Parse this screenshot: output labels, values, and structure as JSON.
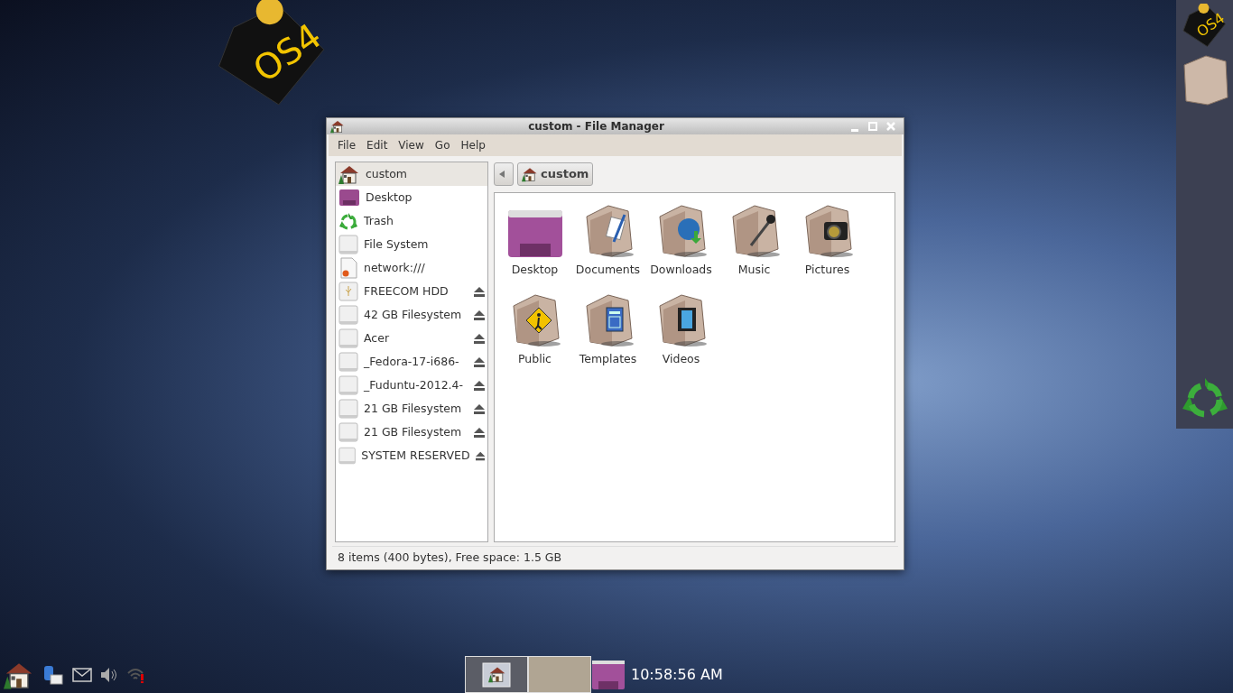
{
  "desktop_logo": {
    "text": "OS4"
  },
  "dock": [
    {
      "kind": "logo",
      "text": "OS4"
    },
    {
      "kind": "folder"
    },
    {
      "kind": "trash"
    }
  ],
  "window": {
    "title": "custom - File Manager"
  },
  "menu": [
    "File",
    "Edit",
    "View",
    "Go",
    "Help"
  ],
  "sidebar": {
    "items": [
      {
        "label": "custom",
        "kind": "home",
        "selected": true,
        "eject": false
      },
      {
        "label": "Desktop",
        "kind": "desktop",
        "selected": false,
        "eject": false
      },
      {
        "label": "Trash",
        "kind": "trash",
        "selected": false,
        "eject": false
      },
      {
        "label": "File System",
        "kind": "drive",
        "selected": false,
        "eject": false
      },
      {
        "label": "network:///",
        "kind": "network",
        "selected": false,
        "eject": false
      },
      {
        "label": "FREECOM HDD",
        "kind": "usb",
        "selected": false,
        "eject": true
      },
      {
        "label": "42 GB Filesystem",
        "kind": "drive",
        "selected": false,
        "eject": true
      },
      {
        "label": "Acer",
        "kind": "drive",
        "selected": false,
        "eject": true
      },
      {
        "label": "_Fedora-17-i686-",
        "kind": "drive",
        "selected": false,
        "eject": true
      },
      {
        "label": "_Fuduntu-2012.4-",
        "kind": "drive",
        "selected": false,
        "eject": true
      },
      {
        "label": "21 GB Filesystem",
        "kind": "drive",
        "selected": false,
        "eject": true
      },
      {
        "label": "21 GB Filesystem",
        "kind": "drive",
        "selected": false,
        "eject": true
      },
      {
        "label": "SYSTEM RESERVED",
        "kind": "drive",
        "selected": false,
        "eject": true
      }
    ]
  },
  "path_bar": {
    "button": "custom"
  },
  "files": [
    {
      "name": "Desktop",
      "kind": "desktop"
    },
    {
      "name": "Documents",
      "kind": "documents"
    },
    {
      "name": "Downloads",
      "kind": "downloads"
    },
    {
      "name": "Music",
      "kind": "music"
    },
    {
      "name": "Pictures",
      "kind": "pictures"
    },
    {
      "name": "Public",
      "kind": "public"
    },
    {
      "name": "Templates",
      "kind": "templates"
    },
    {
      "name": "Videos",
      "kind": "videos"
    }
  ],
  "status_bar": "8 items (400 bytes), Free space: 1.5 GB",
  "taskbar": {
    "tray": [
      {
        "kind": "home"
      },
      {
        "kind": "clipboard"
      },
      {
        "kind": "mail"
      },
      {
        "kind": "volume"
      },
      {
        "kind": "wifi"
      }
    ],
    "tasks": [
      {
        "kind": "file-manager",
        "selected": true
      },
      {
        "kind": "blank",
        "selected": false
      }
    ],
    "show_desktop": true,
    "clock": "10:58:56 AM"
  }
}
